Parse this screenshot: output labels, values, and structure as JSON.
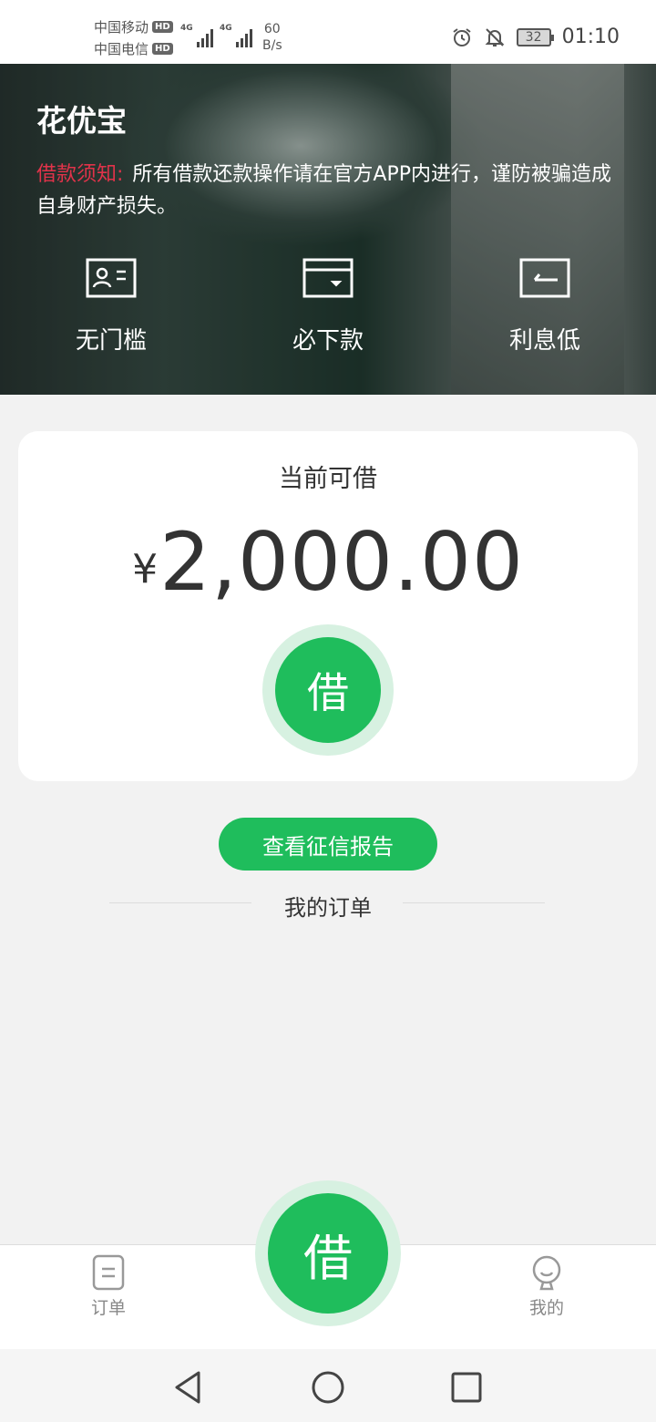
{
  "status_bar": {
    "carrier1": "中国移动",
    "carrier2": "中国电信",
    "hd": "HD",
    "network1": "4G",
    "network2": "4G",
    "speed_value": "60",
    "speed_unit": "B/s",
    "battery": "32",
    "time": "01:10"
  },
  "hero": {
    "app_title": "花优宝",
    "notice_label": "借款须知:",
    "notice_text": "所有借款还款操作请在官方APP内进行，谨防被骗造成自身财产损失。",
    "features": [
      {
        "label": "无门槛",
        "icon": "id-card-icon"
      },
      {
        "label": "必下款",
        "icon": "wallet-icon"
      },
      {
        "label": "利息低",
        "icon": "discount-icon"
      }
    ]
  },
  "loan_card": {
    "title": "当前可借",
    "currency": "¥",
    "amount": "2,000.00",
    "borrow_label": "借"
  },
  "credit_button": "查看征信报告",
  "orders_title": "我的订单",
  "tab_bar": {
    "orders": "订单",
    "borrow": "借",
    "mine": "我的"
  },
  "colors": {
    "accent": "#1fbd5c",
    "accent_light": "#d7f1e1",
    "notice_red": "#e0334a"
  }
}
